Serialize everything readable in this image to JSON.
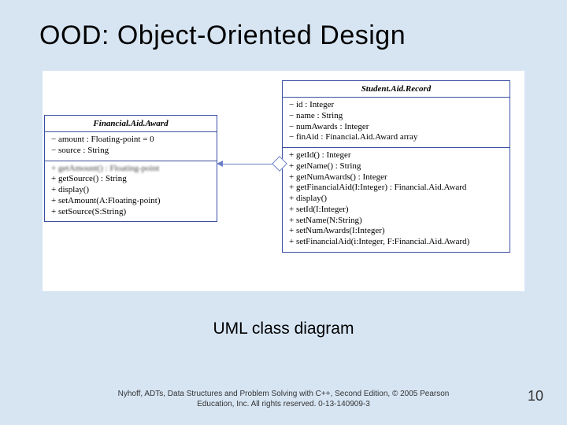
{
  "title": "OOD:  Object-Oriented Design",
  "caption": "UML class diagram",
  "footer_line1": "Nyhoff, ADTs, Data Structures and Problem Solving with C++, Second Edition, © 2005 Pearson",
  "footer_line2": "Education, Inc. All rights reserved. 0-13-140909-3",
  "page_number": "10",
  "classes": {
    "faa": {
      "name": "Financial.Aid.Award",
      "attrs": [
        "− amount : Floating-point = 0",
        "− source : String"
      ],
      "ops": [
        "+ getAmount() : Floating-point",
        "+ getSource() : String",
        "+ display()",
        "+ setAmount(A:Floating-point)",
        "+ setSource(S:String)"
      ]
    },
    "sar": {
      "name": "Student.Aid.Record",
      "attrs": [
        "− id : Integer",
        "− name : String",
        "− numAwards : Integer",
        "− finAid : Financial.Aid.Award array"
      ],
      "ops": [
        "+ getId() : Integer",
        "+ getName() : String",
        "+ getNumAwards() : Integer",
        "+ getFinancialAid(I:Integer) : Financial.Aid.Award",
        "+ display()",
        "+ setId(I:Integer)",
        "+ setName(N:String)",
        "+ setNumAwards(I:Integer)",
        "+ setFinancialAid(i:Integer, F:Financial.Aid.Award)"
      ]
    }
  }
}
